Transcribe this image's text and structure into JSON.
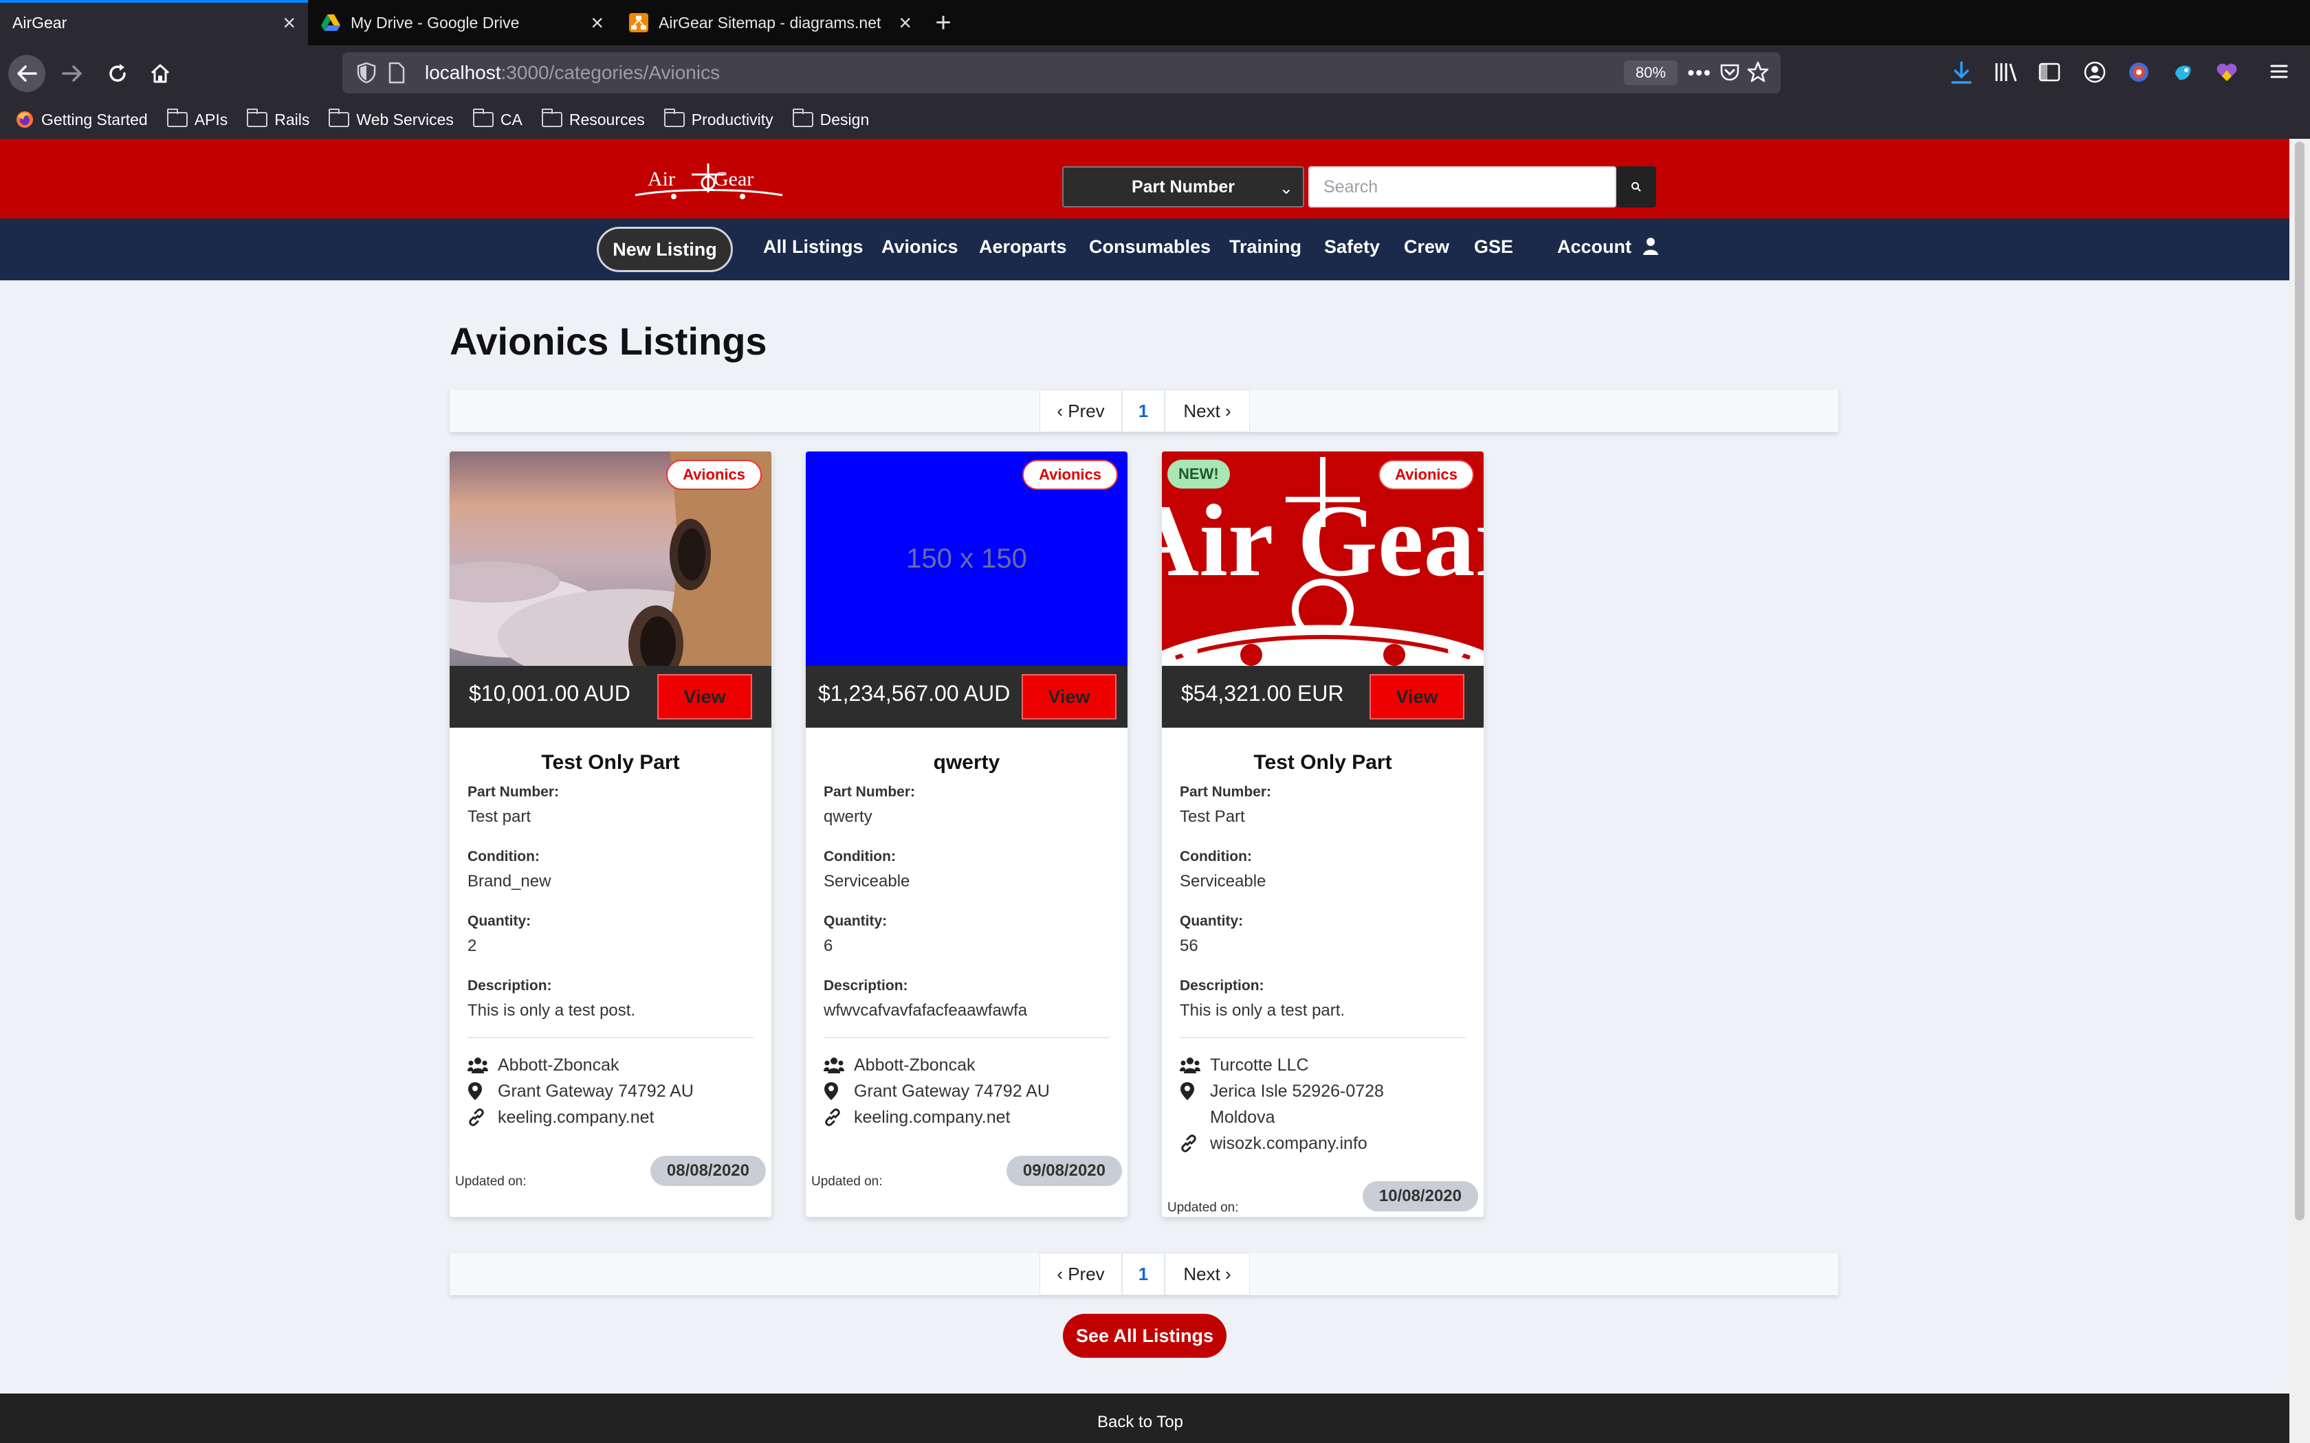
{
  "browser": {
    "tabs": [
      {
        "title": "AirGear",
        "active": true
      },
      {
        "title": "My Drive - Google Drive",
        "active": false
      },
      {
        "title": "AirGear Sitemap - diagrams.net",
        "active": false
      }
    ],
    "url_host": "localhost",
    "url_path": ":3000/categories/Avionics",
    "zoom": "80%",
    "bookmarks": [
      "Getting Started",
      "APIs",
      "Rails",
      "Web Services",
      "CA",
      "Resources",
      "Productivity",
      "Design"
    ]
  },
  "header": {
    "logo_text": "Air Gear",
    "search_select": "Part Number",
    "search_placeholder": "Search"
  },
  "nav": {
    "new_listing": "New Listing",
    "links": [
      "All Listings",
      "Avionics",
      "Aeroparts",
      "Consumables",
      "Training",
      "Safety",
      "Crew",
      "GSE"
    ],
    "account": "Account"
  },
  "page": {
    "title": "Avionics Listings",
    "pager": {
      "prev": "‹ Prev",
      "current": "1",
      "next": "Next ›"
    },
    "see_all": "See All Listings",
    "footer": "Back to Top"
  },
  "labels": {
    "part_number": "Part Number:",
    "condition": "Condition:",
    "quantity": "Quantity:",
    "description": "Description:",
    "updated_on": "Updated on:",
    "view": "View"
  },
  "listings": [
    {
      "category": "Avionics",
      "price": "$10,001.00 AUD",
      "title": "Test Only Part",
      "part_number": "Test part",
      "condition": "Brand_new",
      "quantity": "2",
      "description": "This is only a test post.",
      "company": "Abbott-Zboncak",
      "address": "Grant Gateway 74792 AU",
      "address2": "",
      "website": "keeling.company.net",
      "updated": "08/08/2020",
      "image": "sky-engine",
      "new": false
    },
    {
      "category": "Avionics",
      "price": "$1,234,567.00 AUD",
      "title": "qwerty",
      "part_number": "qwerty",
      "condition": "Serviceable",
      "quantity": "6",
      "description": "wfwvcafvavfafacfeaawfawfa",
      "company": "Abbott-Zboncak",
      "address": "Grant Gateway 74792 AU",
      "address2": "",
      "website": "keeling.company.net",
      "updated": "09/08/2020",
      "image_text": "150 x 150",
      "image": "placeholder",
      "new": false
    },
    {
      "category": "Avionics",
      "new_label": "NEW!",
      "price": "$54,321.00 EUR",
      "title": "Test Only Part",
      "part_number": "Test Part",
      "condition": "Serviceable",
      "quantity": "56",
      "description": "This is only a test part.",
      "company": "Turcotte LLC",
      "address": "Jerica Isle 52926-0728",
      "address2": "Moldova",
      "website": "wisozk.company.info",
      "updated": "10/08/2020",
      "image_text": "Air Gear",
      "image": "airgear-logo",
      "new": true
    }
  ],
  "colors": {
    "brand_red": "#c30000",
    "nav_blue": "#1b2a4a",
    "view_red": "#ee0000"
  }
}
